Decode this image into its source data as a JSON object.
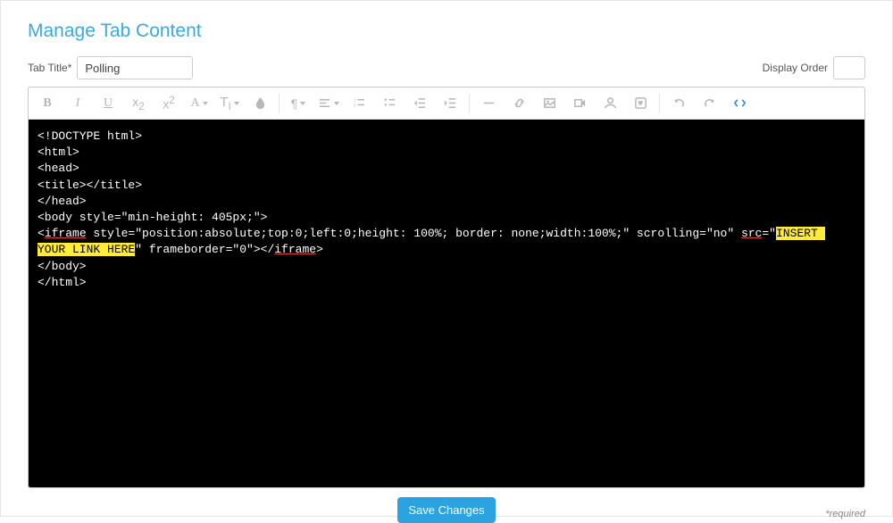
{
  "page": {
    "title": "Manage Tab Content",
    "tabTitleLabel": "Tab Title*",
    "tabTitleValue": "Polling",
    "displayOrderLabel": "Display Order",
    "displayOrderValue": "",
    "saveLabel": "Save Changes",
    "requiredNote": "*required"
  },
  "toolbar": {
    "bold": "B",
    "italic": "I",
    "underline": "U",
    "subscript": "x",
    "subscript_sub": "2",
    "superscript": "x",
    "superscript_sup": "2",
    "fontFamily": "A",
    "fontSize": "T",
    "paragraph": "¶"
  },
  "code": {
    "l1": "<!DOCTYPE html>",
    "l2": "<html>",
    "l3": "<head>",
    "l4": "<title></title>",
    "l5": "</head>",
    "l6": "<body style=\"min-height: 405px;\">",
    "l7a": "<",
    "l7_iframe": "iframe",
    "l7b": " style=\"position:absolute;top:0;left:0;height: 100%; border: none;width:100%;\" scrolling=\"no\" ",
    "l7_src": "src",
    "l7c": "=\"",
    "l7_insert1": "INSERT ",
    "l8_insert2": "YOUR LINK HERE",
    "l8a": "\" frameborder=\"0\"></",
    "l8_iframe2": "iframe",
    "l8b": ">",
    "l9": "</body>",
    "l10": "</html>"
  }
}
